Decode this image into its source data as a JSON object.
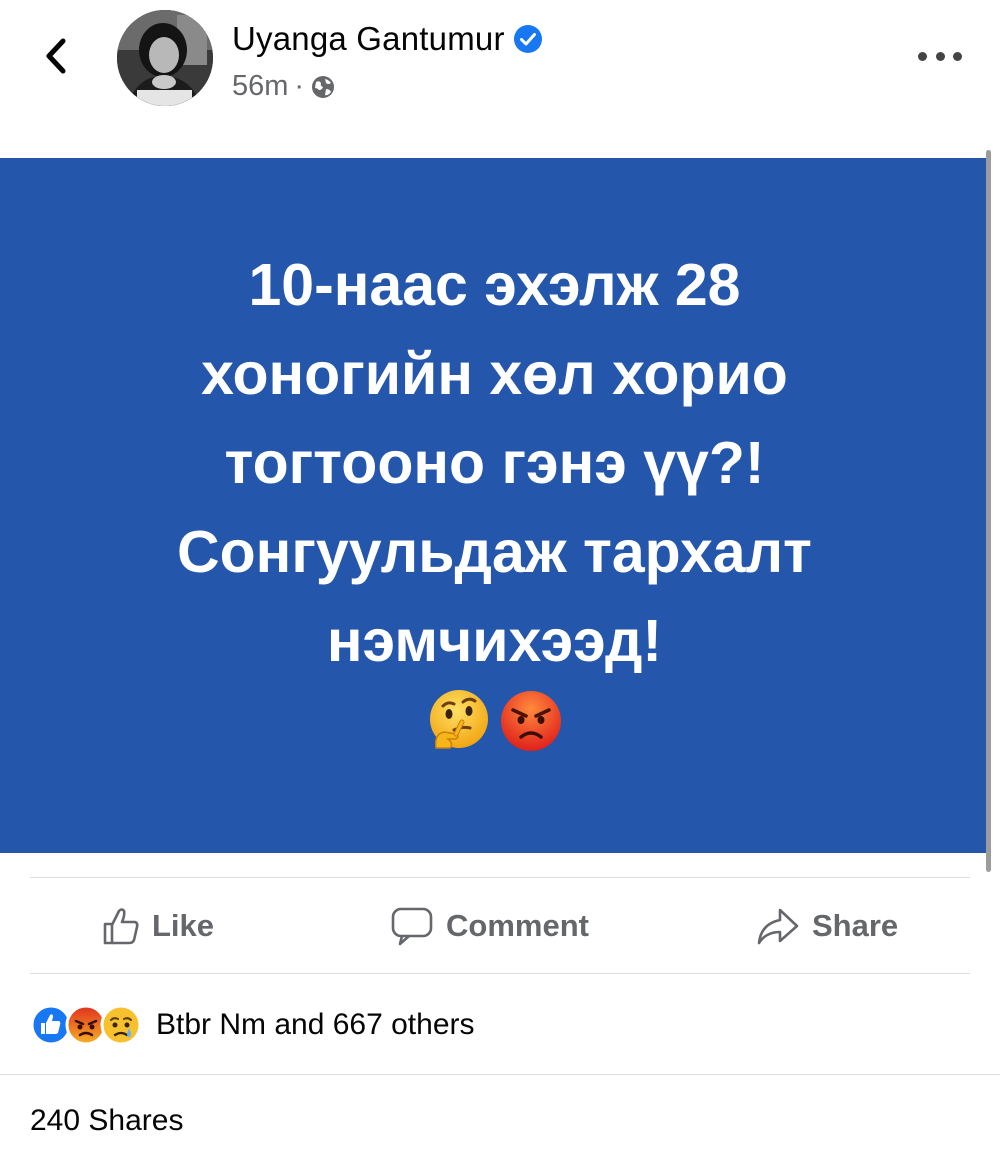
{
  "header": {
    "author_name": "Uyanga Gantumur",
    "timestamp": "56m",
    "separator": "·",
    "icons": {
      "back": "chevron-left-icon",
      "verified": "verified-badge-icon",
      "privacy": "globe-icon",
      "more": "more-horizontal-icon"
    }
  },
  "post": {
    "background_color": "#2456ac",
    "lines": [
      "10-наас эхэлж 28",
      "хоногийн хөл хорио",
      "тогтооно гэнэ үү?!",
      "Сонгуульдаж тархалт",
      "нэмчихээд!"
    ],
    "emojis": [
      "thinking-face-emoji",
      "angry-face-emoji"
    ]
  },
  "actions": {
    "like_label": "Like",
    "comment_label": "Comment",
    "share_label": "Share"
  },
  "reactions": {
    "icons": [
      "like-reaction-icon",
      "angry-reaction-icon",
      "sad-reaction-icon"
    ],
    "summary": "Btbr Nm and 667 others"
  },
  "shares": {
    "label": "240 Shares"
  },
  "colors": {
    "accent": "#1877f2",
    "post_background": "#2456ac",
    "secondary_text": "#65676b"
  }
}
